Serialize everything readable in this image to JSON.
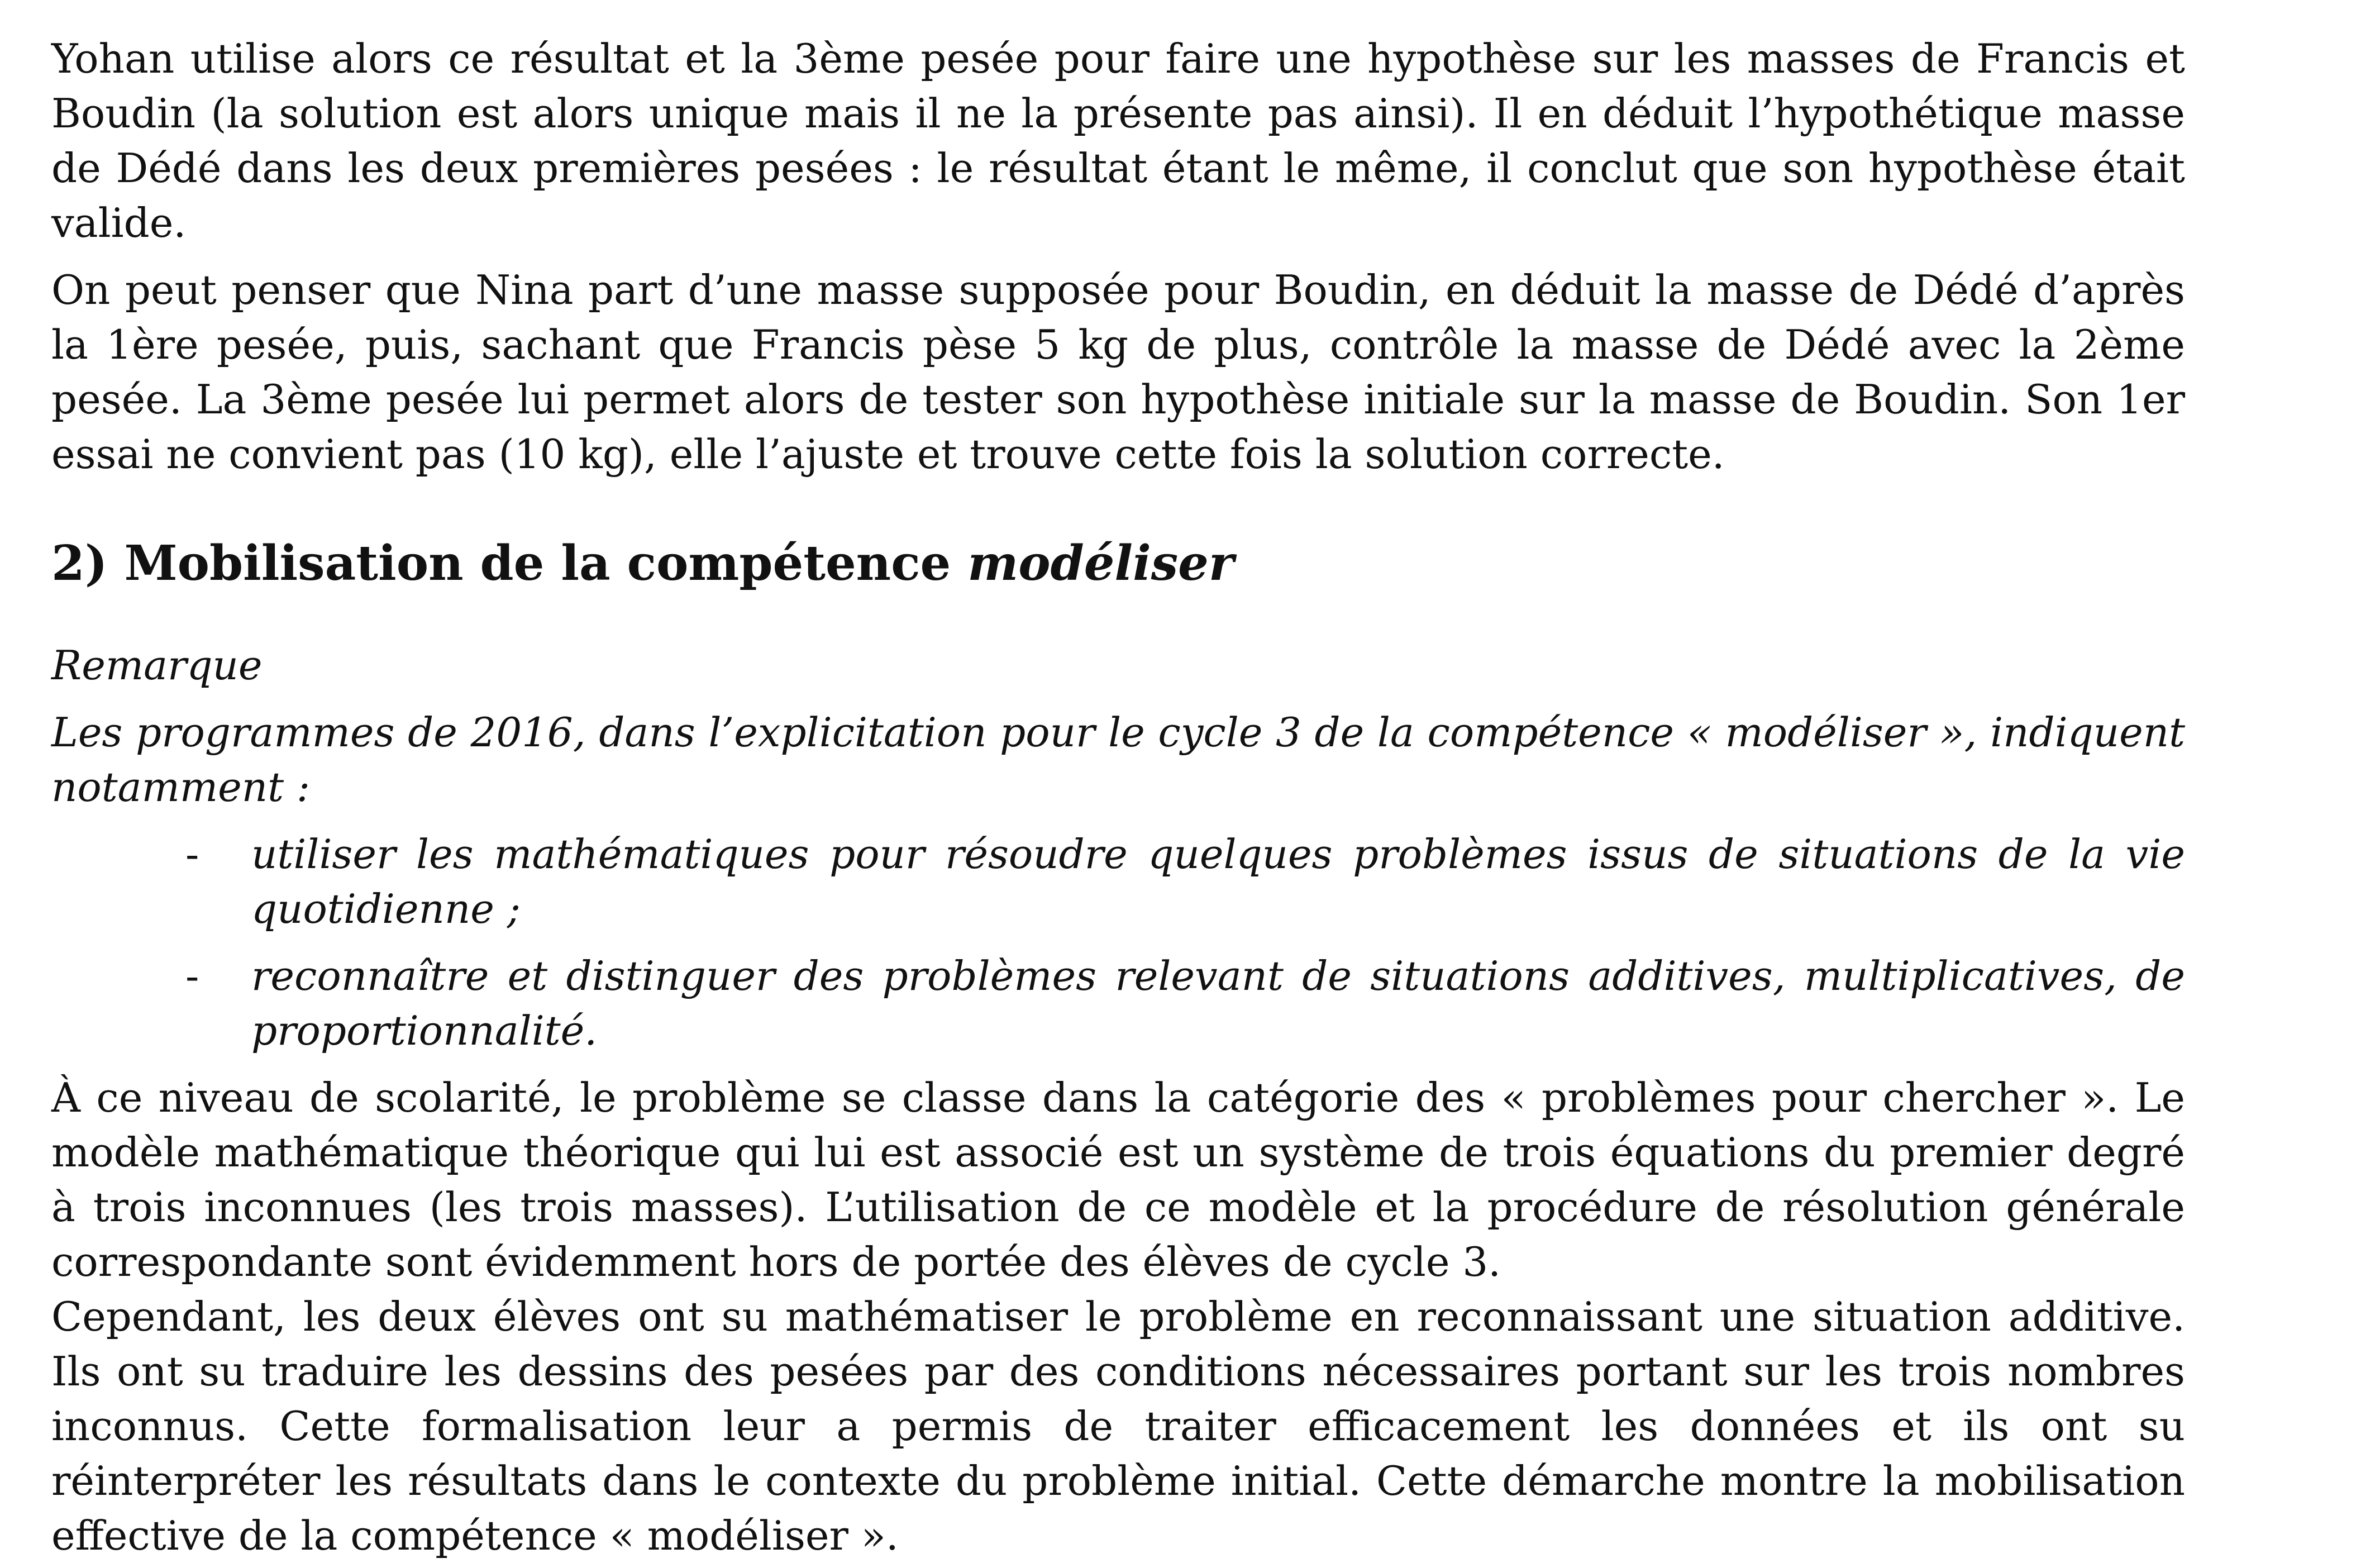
{
  "paragraphs": {
    "p1": "Yohan utilise alors ce résultat et la 3ème pesée pour faire une hypothèse sur les masses de Francis et Boudin (la solution est alors unique mais il ne la présente pas ainsi). Il en déduit l’hypothétique masse de Dédé dans les deux premières pesées : le résultat étant le même, il conclut que son hypothèse était valide.",
    "p2": "On peut penser que Nina part d’une masse supposée pour Boudin, en déduit la masse de Dédé d’après la 1ère pesée, puis, sachant que Francis pèse 5 kg de plus, contrôle la masse de Dédé avec la 2ème pesée. La 3ème pesée lui permet alors de tester son hypothèse initiale sur la masse de Boudin. Son 1er essai ne convient pas (10 kg), elle l’ajuste et trouve cette fois la solution correcte."
  },
  "section": {
    "heading_plain": "2) Mobilisation de la compétence ",
    "heading_italic": "modéliser"
  },
  "remark": {
    "title": "Remarque",
    "intro": "Les programmes de 2016, dans l’explicitation pour le cycle 3 de la compétence « modéliser », indiquent notamment :",
    "bullet_marker": "-",
    "bullets": [
      "utiliser les mathématiques pour résoudre quelques problèmes issus de situations de la vie quotidienne ;",
      "reconnaître et distinguer des problèmes relevant de situations additives, multiplicatives, de proportionnalité."
    ]
  },
  "body": {
    "p3": "À ce niveau de scolarité, le problème se classe dans la catégorie des « problèmes pour chercher ». Le modèle mathématique théorique qui lui est associé est un système de trois équations du premier degré à trois inconnues (les trois masses). L’utilisation de ce modèle et la procédure de résolution générale correspondante sont évidemment hors de portée des élèves de cycle 3.",
    "p4": "Cependant, les deux élèves ont su mathématiser le problème en reconnaissant une situation additive. Ils ont su traduire les dessins des pesées par des conditions nécessaires portant sur les trois nombres inconnus. Cette formalisation leur a permis de traiter efficacement les données et ils ont su réinterpréter les résultats dans le contexte du problème initial. Cette démarche montre la mobilisation effective de la compétence « modéliser »."
  }
}
